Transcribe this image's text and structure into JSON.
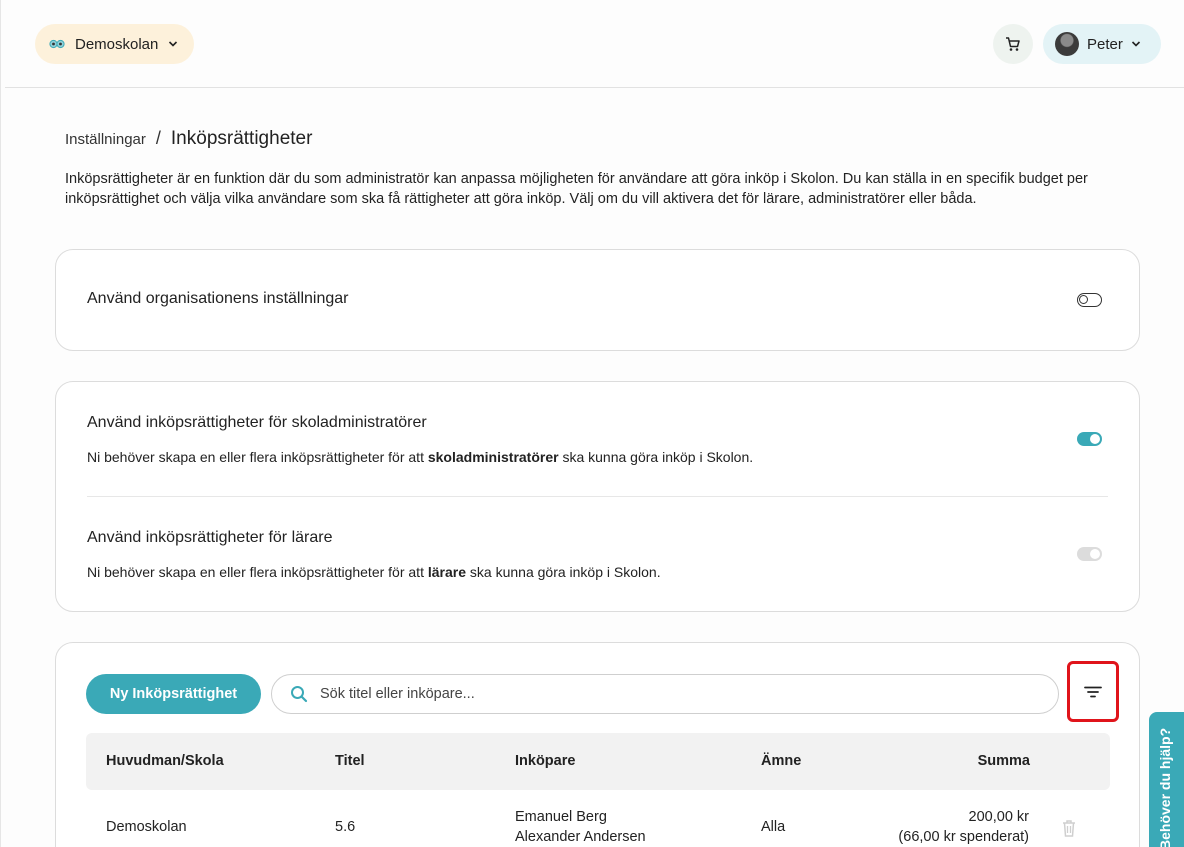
{
  "header": {
    "school_name": "Demoskolan",
    "user_name": "Peter"
  },
  "breadcrumb": {
    "parent": "Inställningar",
    "separator": "/",
    "current": "Inköpsrättigheter"
  },
  "intro": "Inköpsrättigheter är en funktion där du som administratör kan anpassa möjligheten för användare att göra inköp i Skolon. Du kan ställa in en specifik budget per inköpsrättighet och välja vilka användare som ska få rättigheter att göra inköp. Välj om du vill aktivera det för lärare, administratörer eller båda.",
  "org_settings": {
    "title": "Använd organisationens inställningar",
    "enabled": false
  },
  "admin_rights": {
    "title": "Använd inköpsrättigheter för skoladministratörer",
    "desc_pre": "Ni behöver skapa en eller flera inköpsrättigheter för att ",
    "desc_bold": "skoladministratörer",
    "desc_post": " ska kunna göra inköp i Skolon.",
    "enabled": true
  },
  "teacher_rights": {
    "title": "Använd inköpsrättigheter för lärare",
    "desc_pre": "Ni behöver skapa en eller flera inköpsrättigheter för att ",
    "desc_bold": "lärare",
    "desc_post": " ska kunna göra inköp i Skolon.",
    "enabled": true,
    "disabled": true
  },
  "toolbar": {
    "new_button": "Ny Inköpsrättighet",
    "search_placeholder": "Sök titel eller inköpare..."
  },
  "table": {
    "columns": [
      "Huvudman/Skola",
      "Titel",
      "Inköpare",
      "Ämne",
      "Summa"
    ],
    "rows": [
      {
        "school": "Demoskolan",
        "title": "5.6",
        "buyer_1": "Emanuel Berg",
        "buyer_2": "Alexander Andersen",
        "subject": "Alla",
        "sum": "200,00 kr",
        "spent": "(66,00 kr spenderat)"
      }
    ]
  },
  "help_tab": "Behöver du hjälp?",
  "colors": {
    "accent": "#3aa9b7",
    "school_pill_bg": "#fdf1db",
    "user_pill_bg": "#e3f3f6",
    "highlight": "#e0141b"
  }
}
